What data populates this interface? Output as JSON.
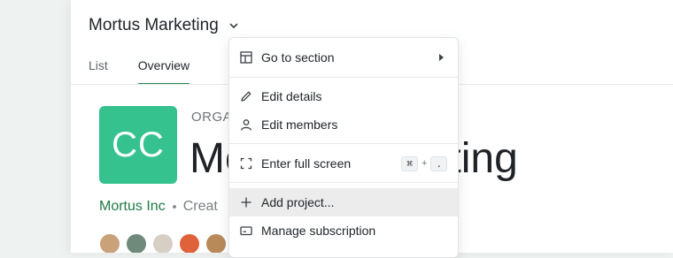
{
  "header": {
    "title": "Mortus Marketing"
  },
  "tabs": [
    {
      "label": "List"
    },
    {
      "label": "Overview",
      "active": true
    }
  ],
  "org": {
    "avatar_initials": "CC",
    "label": "ORGA",
    "name": "Mortus Marketing",
    "company": "Mortus Inc",
    "created": "Creat"
  },
  "menu": {
    "items": [
      {
        "label": "Go to section",
        "icon": "layout-icon",
        "submenu": true
      },
      {
        "label": "Edit details",
        "icon": "pencil-icon"
      },
      {
        "label": "Edit members",
        "icon": "person-icon"
      },
      {
        "label": "Enter full screen",
        "icon": "fullscreen-icon",
        "shortcut": {
          "key1": "⌘",
          "plus": "+",
          "key2": "."
        }
      },
      {
        "label": "Add project...",
        "icon": "plus-icon",
        "highlighted": true
      },
      {
        "label": "Manage subscription",
        "icon": "card-icon"
      }
    ]
  },
  "colors": {
    "accent": "#2a8a4f",
    "avatar_bg": "#35c28f",
    "company_link": "#1f7a44"
  }
}
